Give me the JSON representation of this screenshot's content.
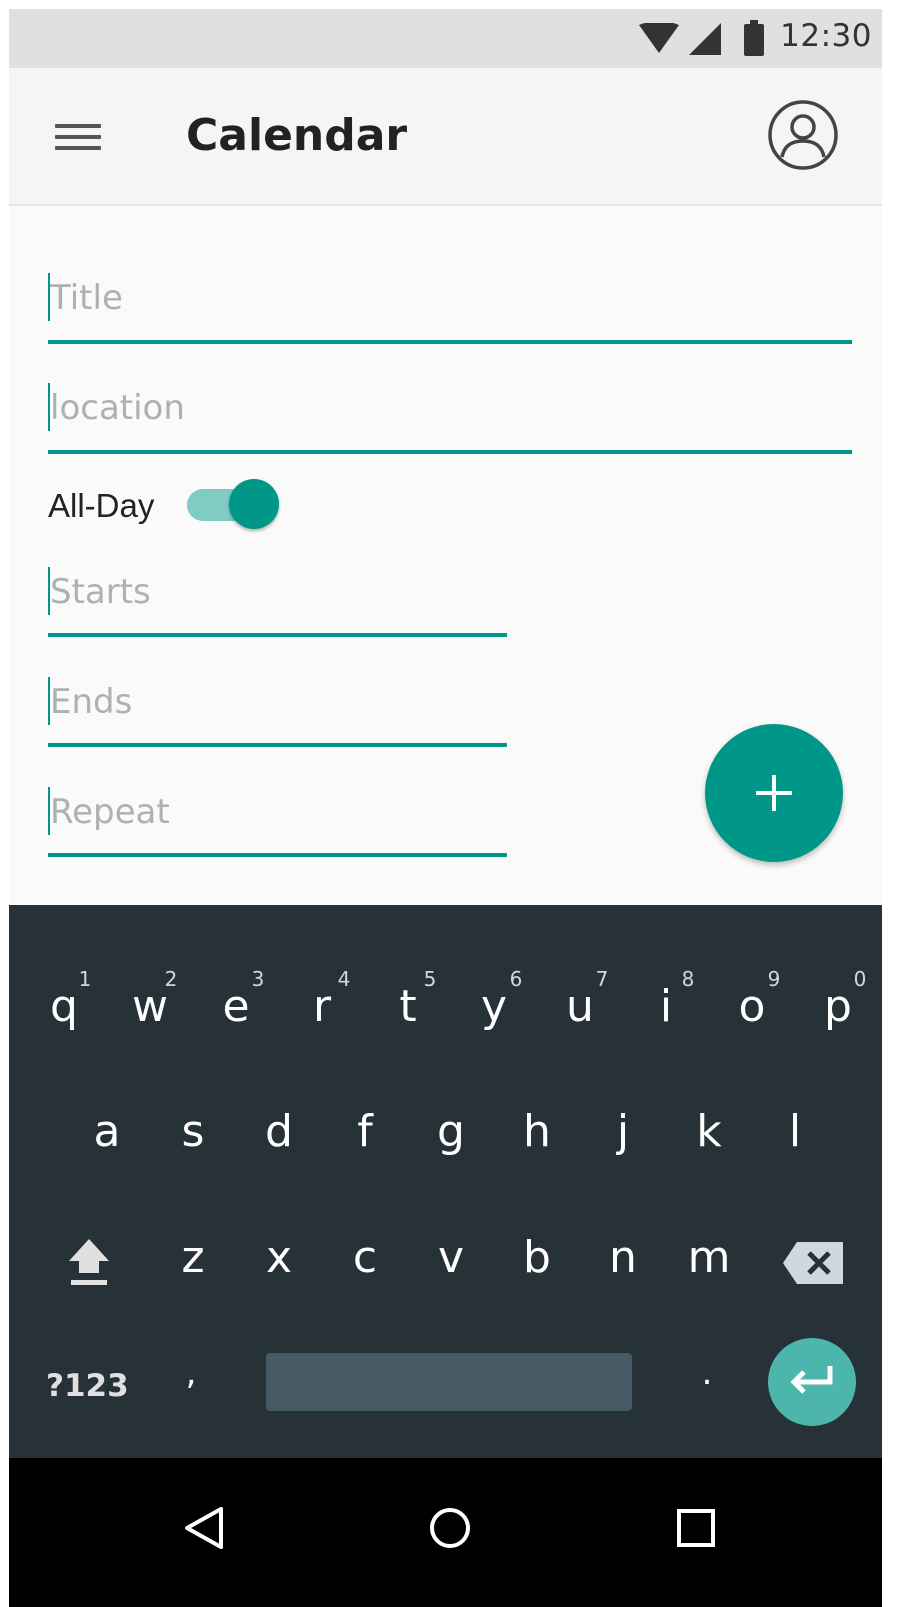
{
  "status_bar": {
    "time": "12:30"
  },
  "app_bar": {
    "title": "Calendar"
  },
  "form": {
    "title_placeholder": "Title",
    "location_placeholder": "location",
    "all_day_label": "All-Day",
    "all_day_on": true,
    "starts_placeholder": "Starts",
    "ends_placeholder": "Ends",
    "repeat_placeholder": "Repeat"
  },
  "keyboard": {
    "row1": [
      "q",
      "w",
      "e",
      "r",
      "t",
      "y",
      "u",
      "i",
      "o",
      "p"
    ],
    "row1_hints": [
      "1",
      "2",
      "3",
      "4",
      "5",
      "6",
      "7",
      "8",
      "9",
      "0"
    ],
    "row2": [
      "a",
      "s",
      "d",
      "f",
      "g",
      "h",
      "j",
      "k",
      "l"
    ],
    "row3": [
      "z",
      "x",
      "c",
      "v",
      "b",
      "n",
      "m"
    ],
    "symbols_label": "?123",
    "comma": ",",
    "period": "."
  },
  "colors": {
    "accent": "#009688",
    "keyboard_bg": "#263238"
  }
}
